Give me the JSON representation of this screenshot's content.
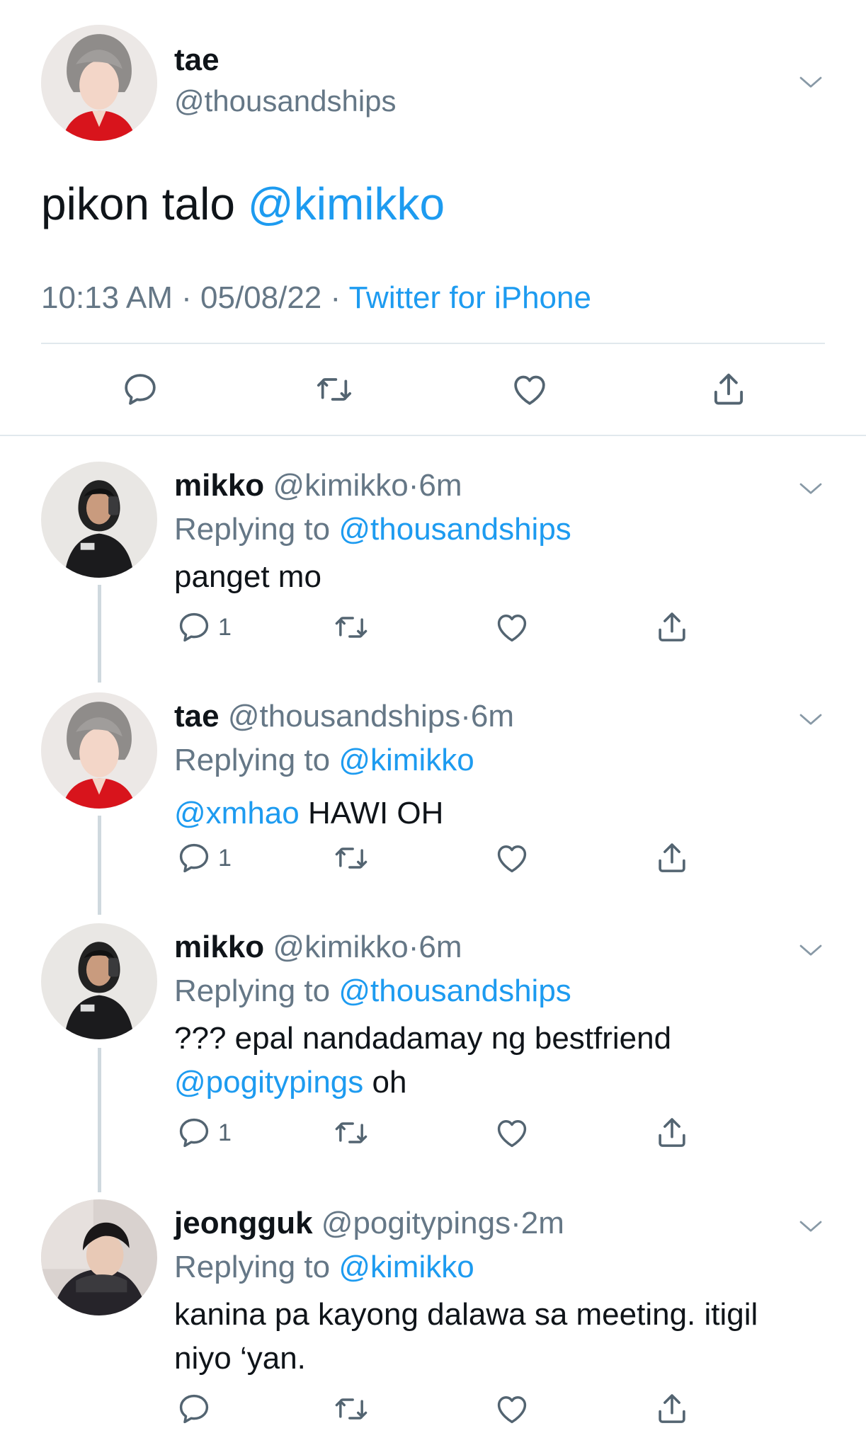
{
  "main": {
    "name": "tae",
    "handle": "@thousandships",
    "text_plain": "pikon talo ",
    "text_mention": "@kimikko",
    "time": "10:13 AM · 05/08/22 · ",
    "source": "Twitter for iPhone"
  },
  "replies": [
    {
      "name": "mikko",
      "handle": "@kimikko",
      "time": "6m",
      "replying_label": "Replying to ",
      "replying_to": "@thousandships",
      "body_line1": "panget mo",
      "reply_count": "1"
    },
    {
      "name": "tae",
      "handle": "@thousandships",
      "time": "6m",
      "replying_label": "Replying to ",
      "replying_to": "@kimikko",
      "body_mention": "@xmhao",
      "body_text": " HAWI OH",
      "reply_count": "1"
    },
    {
      "name": "mikko",
      "handle": "@kimikko",
      "time": "6m",
      "replying_label": "Replying to ",
      "replying_to": "@thousandships",
      "body_line1": "??? epal nandadamay ng bestfriend",
      "body_mention": "@pogitypings",
      "body_text": " oh",
      "reply_count": "1"
    },
    {
      "name": "jeongguk",
      "handle": "@pogitypings",
      "time": "2m",
      "replying_label": "Replying to ",
      "replying_to": "@kimikko",
      "body_line1": "kanina pa kayong dalawa sa meeting. itigil niyo ‘yan."
    }
  ],
  "sep_dot": "·",
  "icons": [
    "reply-icon",
    "retweet-icon",
    "like-icon",
    "share-icon",
    "chevron-down-icon"
  ],
  "colors": {
    "link": "#1d9bf0",
    "muted": "#657786",
    "divider": "#e1e8ed"
  }
}
